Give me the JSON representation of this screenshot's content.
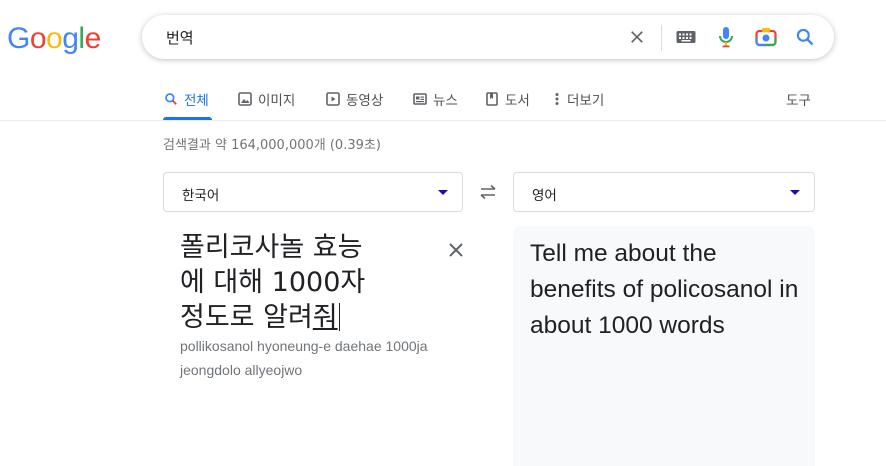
{
  "logo": {
    "letters": [
      "G",
      "o",
      "o",
      "g",
      "l",
      "e"
    ],
    "colors": [
      "#4285f4",
      "#ea4335",
      "#fbbc05",
      "#4285f4",
      "#34a853",
      "#ea4335"
    ]
  },
  "search": {
    "query": "번역",
    "icons": [
      "close-icon",
      "keyboard-icon",
      "mic-icon",
      "camera-icon",
      "search-icon"
    ]
  },
  "tabs": [
    {
      "label": "전체",
      "icon": "search-icon",
      "active": true
    },
    {
      "label": "이미지",
      "icon": "image-icon"
    },
    {
      "label": "동영상",
      "icon": "video-icon"
    },
    {
      "label": "뉴스",
      "icon": "news-icon"
    },
    {
      "label": "도서",
      "icon": "book-icon"
    },
    {
      "label": "더보기",
      "icon": "more-vert-icon"
    }
  ],
  "tools_label": "도구",
  "result_stats": "검색결과 약 164,000,000개 (0.39초)",
  "translate": {
    "source_lang": "한국어",
    "target_lang": "영어",
    "source_lines": [
      "폴리코사놀 효능",
      "에 대해 1000자",
      "정도로 알려"
    ],
    "source_last": "줘",
    "romanization": "pollikosanol hyoneung-e daehae 1000ja jeongdolo allyeojwo",
    "translation": "Tell me about the benefits of policosanol in about 1000 words"
  },
  "colors": {
    "accent": "#1a73e8",
    "muted": "#70757a",
    "caret": "#1a0dab"
  }
}
